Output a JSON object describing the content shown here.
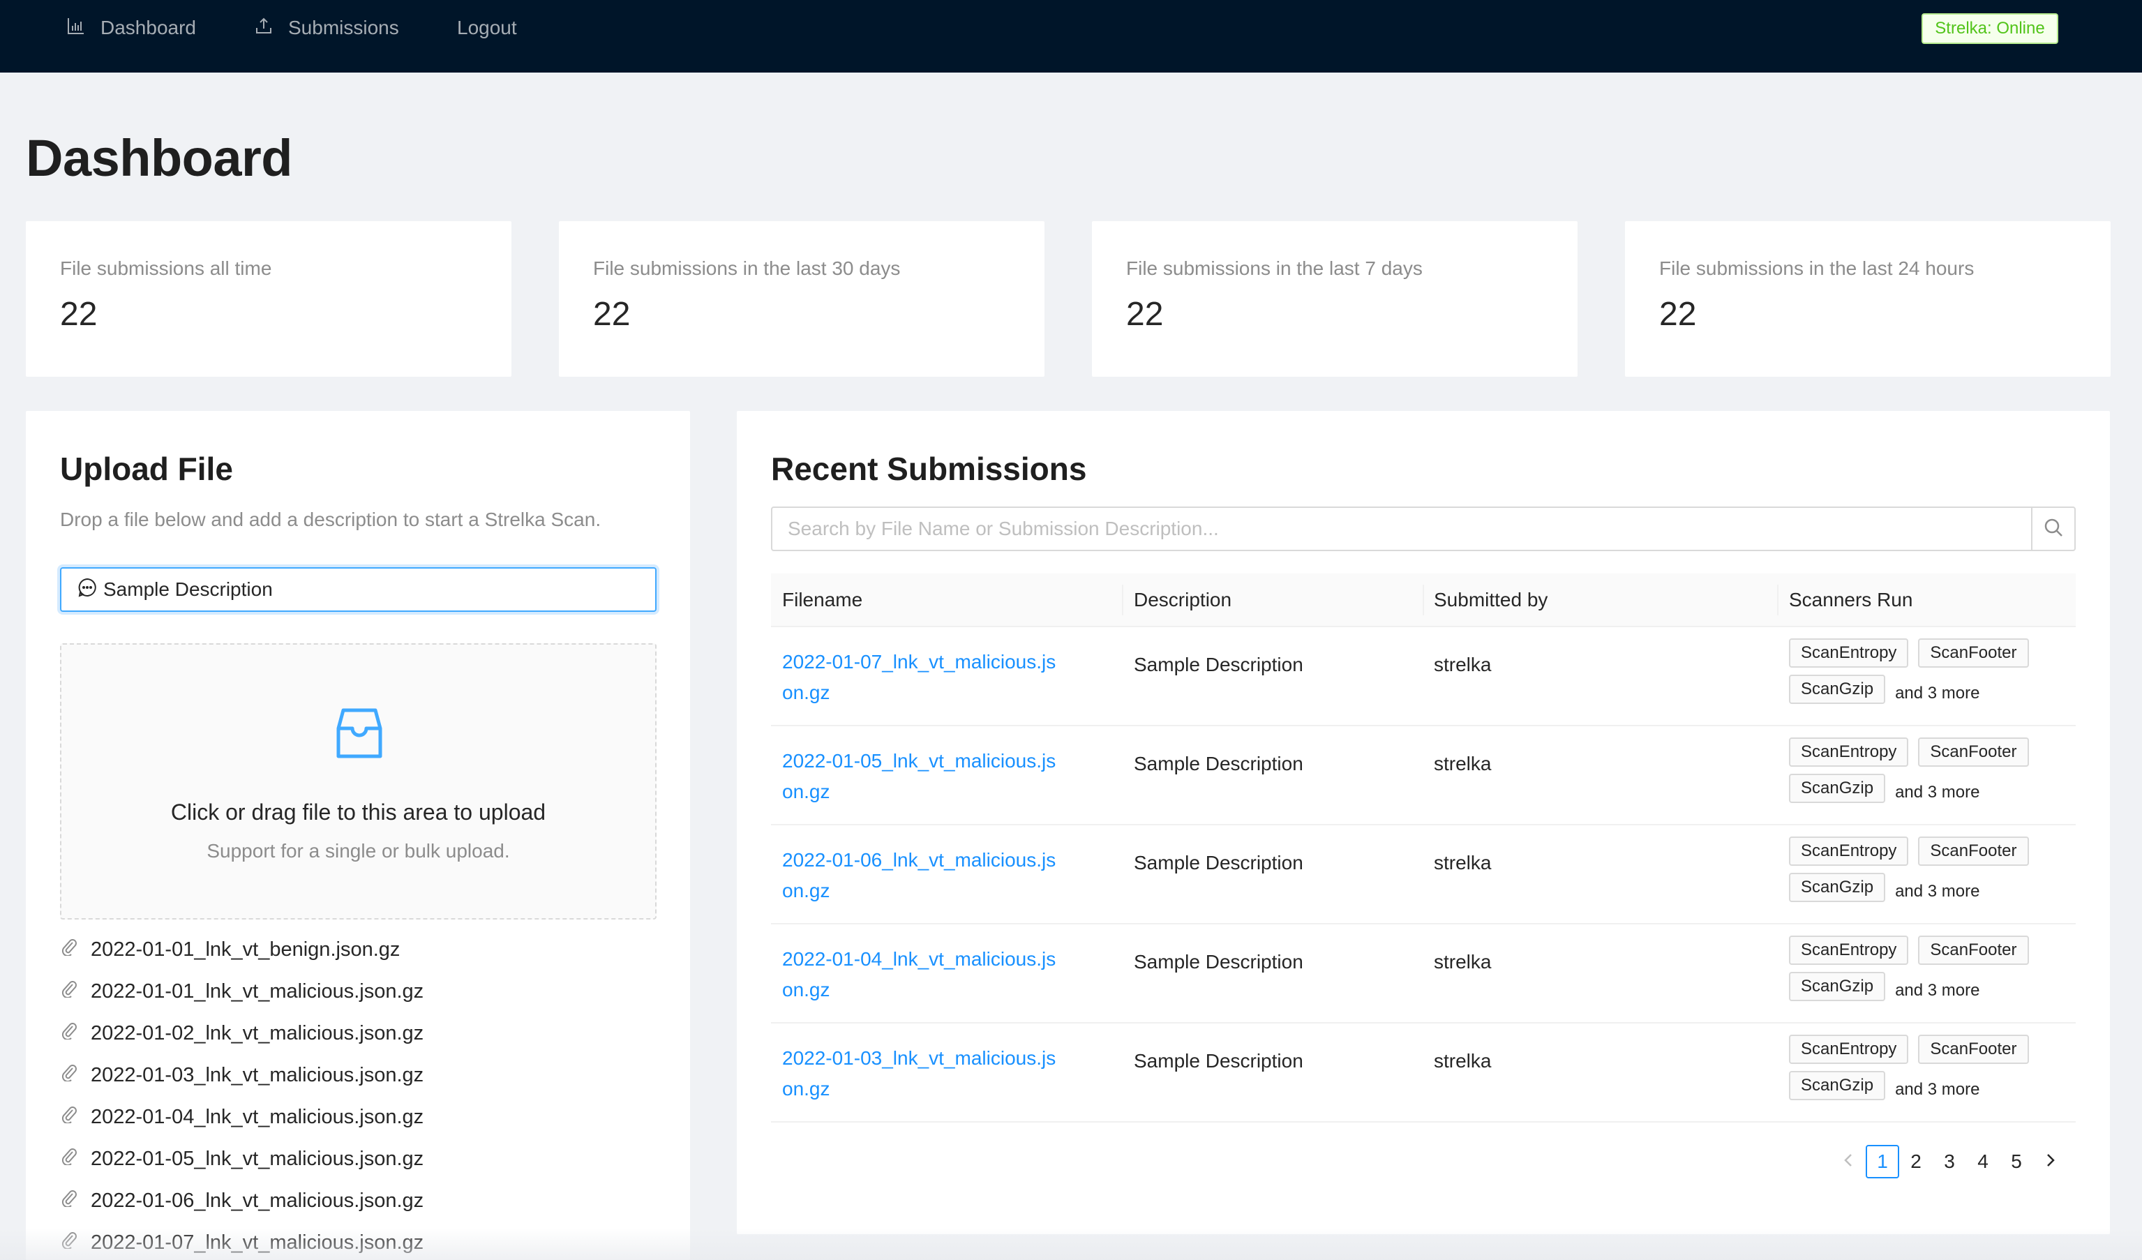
{
  "nav": {
    "items": [
      {
        "label": "Dashboard",
        "icon": "bar-chart-icon"
      },
      {
        "label": "Submissions",
        "icon": "upload-icon"
      },
      {
        "label": "Logout",
        "icon": null
      }
    ],
    "status": "Strelka: Online"
  },
  "page": {
    "title": "Dashboard"
  },
  "stats": [
    {
      "label": "File submissions all time",
      "value": "22"
    },
    {
      "label": "File submissions in the last 30 days",
      "value": "22"
    },
    {
      "label": "File submissions in the last 7 days",
      "value": "22"
    },
    {
      "label": "File submissions in the last 24 hours",
      "value": "22"
    }
  ],
  "upload": {
    "title": "Upload File",
    "hint": "Drop a file below and add a description to start a Strelka Scan.",
    "description_value": "Sample Description",
    "dropzone_text": "Click or drag file to this area to upload",
    "dropzone_hint": "Support for a single or bulk upload.",
    "files": [
      "2022-01-01_lnk_vt_benign.json.gz",
      "2022-01-01_lnk_vt_malicious.json.gz",
      "2022-01-02_lnk_vt_malicious.json.gz",
      "2022-01-03_lnk_vt_malicious.json.gz",
      "2022-01-04_lnk_vt_malicious.json.gz",
      "2022-01-05_lnk_vt_malicious.json.gz",
      "2022-01-06_lnk_vt_malicious.json.gz",
      "2022-01-07_lnk_vt_malicious.json.gz"
    ]
  },
  "submissions": {
    "title": "Recent Submissions",
    "search_placeholder": "Search by File Name or Submission Description...",
    "columns": [
      "Filename",
      "Description",
      "Submitted by",
      "Scanners Run"
    ],
    "rows": [
      {
        "filename": "2022-01-07_lnk_vt_malicious.json.gz",
        "description": "Sample Description",
        "submitted_by": "strelka",
        "scanners": [
          "ScanEntropy",
          "ScanFooter",
          "ScanGzip"
        ],
        "more": "and 3 more"
      },
      {
        "filename": "2022-01-05_lnk_vt_malicious.json.gz",
        "description": "Sample Description",
        "submitted_by": "strelka",
        "scanners": [
          "ScanEntropy",
          "ScanFooter",
          "ScanGzip"
        ],
        "more": "and 3 more"
      },
      {
        "filename": "2022-01-06_lnk_vt_malicious.json.gz",
        "description": "Sample Description",
        "submitted_by": "strelka",
        "scanners": [
          "ScanEntropy",
          "ScanFooter",
          "ScanGzip"
        ],
        "more": "and 3 more"
      },
      {
        "filename": "2022-01-04_lnk_vt_malicious.json.gz",
        "description": "Sample Description",
        "submitted_by": "strelka",
        "scanners": [
          "ScanEntropy",
          "ScanFooter",
          "ScanGzip"
        ],
        "more": "and 3 more"
      },
      {
        "filename": "2022-01-03_lnk_vt_malicious.json.gz",
        "description": "Sample Description",
        "submitted_by": "strelka",
        "scanners": [
          "ScanEntropy",
          "ScanFooter",
          "ScanGzip"
        ],
        "more": "and 3 more"
      }
    ],
    "pagination": {
      "pages": [
        "1",
        "2",
        "3",
        "4",
        "5"
      ],
      "current": "1"
    }
  },
  "colors": {
    "nav_bg": "#001529",
    "accent": "#1890ff",
    "status_green": "#52c41a",
    "page_bg": "#f0f2f5"
  }
}
